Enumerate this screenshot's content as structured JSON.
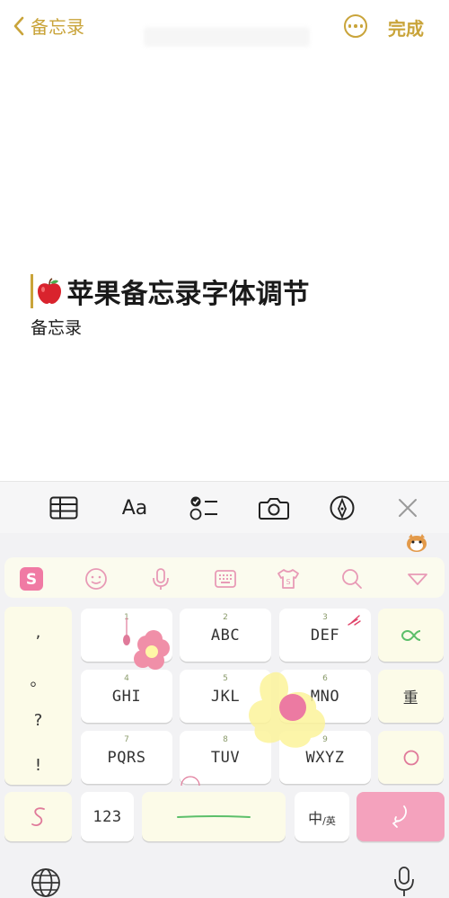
{
  "nav": {
    "back_label": "备忘录",
    "done_label": "完成"
  },
  "note": {
    "title": "苹果备忘录字体调节",
    "subtitle": "备忘录"
  },
  "toolbar": {
    "font_label": "Aa"
  },
  "keyboard": {
    "punctuation": [
      ",",
      "。",
      "?",
      "!"
    ],
    "rows": [
      [
        {
          "num": "1",
          "label": ""
        },
        {
          "num": "2",
          "label": "ABC"
        },
        {
          "num": "3",
          "label": "DEF"
        }
      ],
      [
        {
          "num": "4",
          "label": "GHI"
        },
        {
          "num": "5",
          "label": "JKL"
        },
        {
          "num": "6",
          "label": "MNO"
        }
      ],
      [
        {
          "num": "7",
          "label": "PQRS"
        },
        {
          "num": "8",
          "label": "TUV"
        },
        {
          "num": "9",
          "label": "WXYZ"
        }
      ]
    ],
    "redo_label": "重",
    "numbers_label": "123",
    "lang_main": "中",
    "lang_sub": "/英"
  },
  "colors": {
    "accent": "#c9a43a",
    "enter_key": "#f4a2bd",
    "sogou_pink": "#f07aa4"
  }
}
